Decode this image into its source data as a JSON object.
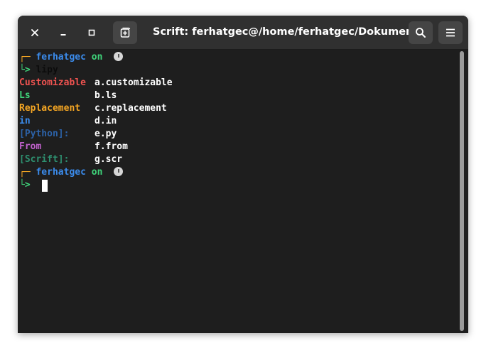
{
  "window": {
    "title": "Scrift: ferhatgec@/home/ferhatgec/Dokumente"
  },
  "icons": {
    "close": "close-icon",
    "minimize": "minimize-icon",
    "maximize": "maximize-icon",
    "new_tab": "new-tab-icon",
    "search": "search-icon",
    "menu": "hamburger-menu-icon"
  },
  "prompt": {
    "user": "ferhatgec",
    "on": "on",
    "bracket_top": "┌─",
    "arrow": "└>"
  },
  "command": "lipy",
  "output": [
    {
      "label": "Customizable",
      "value": "a.customizable",
      "color": "#ef5350"
    },
    {
      "label": "Ls",
      "value": "b.ls",
      "color": "#3fd47a"
    },
    {
      "label": "Replacement",
      "value": "c.replacement",
      "color": "#f5a623"
    },
    {
      "label": "in",
      "value": "d.in",
      "color": "#3b8beb"
    },
    {
      "label": "[Python]:",
      "value": "e.py",
      "color": "#2c62a8"
    },
    {
      "label": "From",
      "value": "f.from",
      "color": "#c061cb"
    },
    {
      "label": "[Scrift]:",
      "value": "g.scr",
      "color": "#2e9070"
    }
  ]
}
